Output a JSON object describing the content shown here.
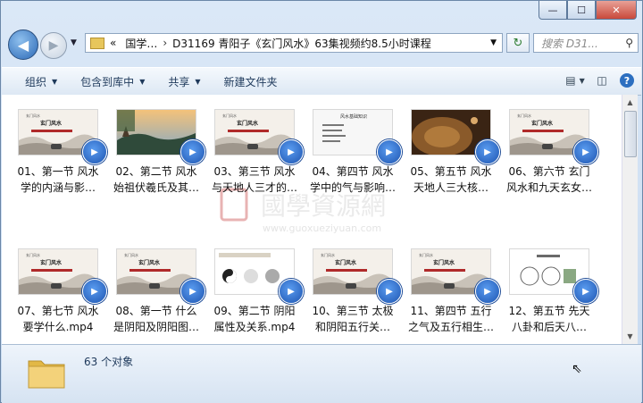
{
  "window": {
    "caption_buttons": {
      "minimize": "—",
      "maximize": "☐",
      "close": "✕"
    }
  },
  "nav": {
    "address_prefix": "«",
    "crumb1": "国学…",
    "crumb_sep": "›",
    "crumb2": "D31169 青阳子《玄门风水》63集视频约8.5小时课程",
    "search_placeholder": "搜索 D31..."
  },
  "toolbar": {
    "organize": "组织",
    "include_library": "包含到库中",
    "share": "共享",
    "new_folder": "新建文件夹"
  },
  "files": [
    {
      "line1": "01、第一节 风水",
      "line2": "学的内涵与影…",
      "thumb": "slide"
    },
    {
      "line1": "02、第二节 风水",
      "line2": "始祖伏羲氏及其…",
      "thumb": "photo"
    },
    {
      "line1": "03、第三节 风水",
      "line2": "与天地人三才的…",
      "thumb": "slide"
    },
    {
      "line1": "04、第四节 风水",
      "line2": "学中的气与影响…",
      "thumb": "doc"
    },
    {
      "line1": "05、第五节 风水",
      "line2": "天地人三大核…",
      "thumb": "bronze"
    },
    {
      "line1": "06、第六节 玄门",
      "line2": "风水和九天玄女…",
      "thumb": "slide"
    },
    {
      "line1": "07、第七节 风水",
      "line2": "要学什么.mp4",
      "thumb": "slide"
    },
    {
      "line1": "08、第一节 什么",
      "line2": "是阴阳及阴阳图…",
      "thumb": "slide"
    },
    {
      "line1": "09、第二节 阴阳",
      "line2": "属性及关系.mp4",
      "thumb": "yinyang"
    },
    {
      "line1": "10、第三节 太极",
      "line2": "和阴阳五行关…",
      "thumb": "slide"
    },
    {
      "line1": "11、第四节 五行",
      "line2": "之气及五行相生…",
      "thumb": "slide"
    },
    {
      "line1": "12、第五节 先天",
      "line2": "八卦和后天八…",
      "thumb": "bagua"
    }
  ],
  "watermark": {
    "text": "國學資源網",
    "url": "www.guoxueziyuan.com"
  },
  "status": {
    "count": "63 个对象"
  }
}
